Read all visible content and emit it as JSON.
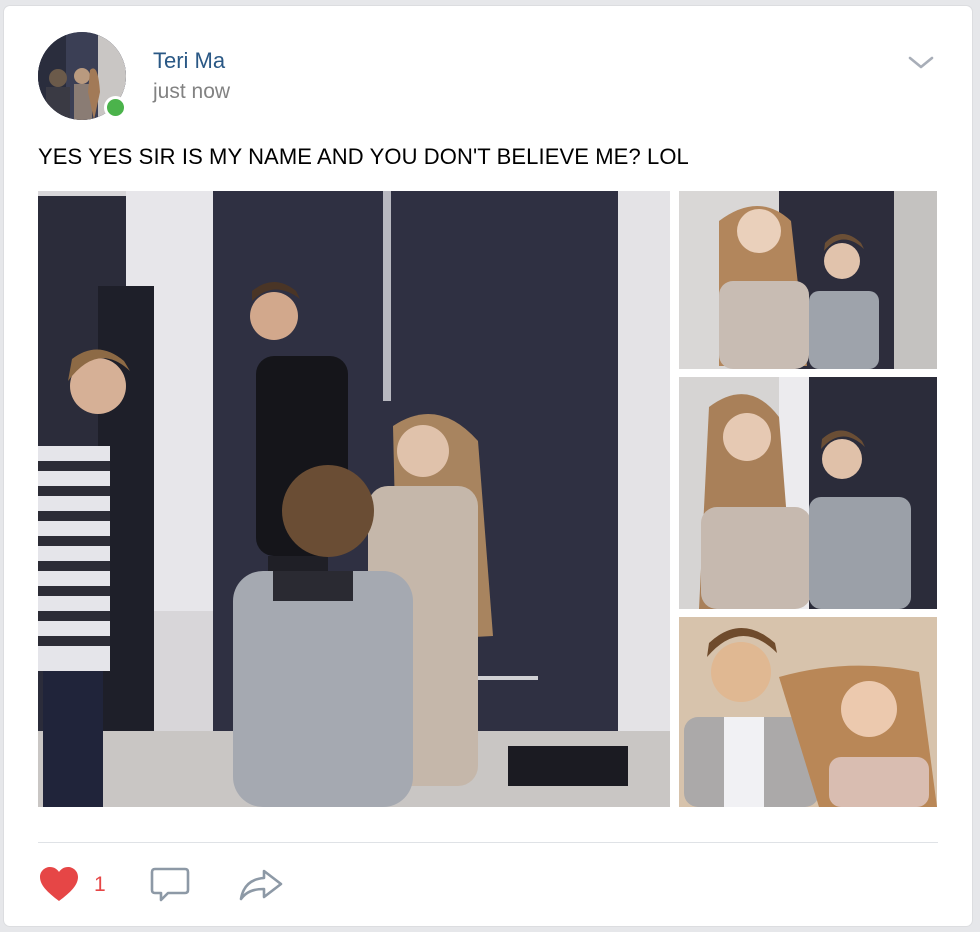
{
  "post": {
    "author": "Teri Ma",
    "time": "just now",
    "text": "YES YES SIR IS MY NAME AND YOU DON'T BELIEVE ME? LOL",
    "online_status_color": "#4bb34b"
  },
  "actions": {
    "like_count": "1",
    "like_color": "#e64646",
    "icons": [
      "heart-icon",
      "comment-icon",
      "share-icon"
    ]
  },
  "menu": {
    "icon": "chevron-down-icon"
  },
  "attachments": {
    "photo_count": 4,
    "icons": [
      "photo-main",
      "photo-1",
      "photo-2",
      "photo-3"
    ]
  },
  "theme": {
    "link_color": "#2a5885",
    "muted_text": "#828282",
    "background": "#e6e7ea"
  }
}
